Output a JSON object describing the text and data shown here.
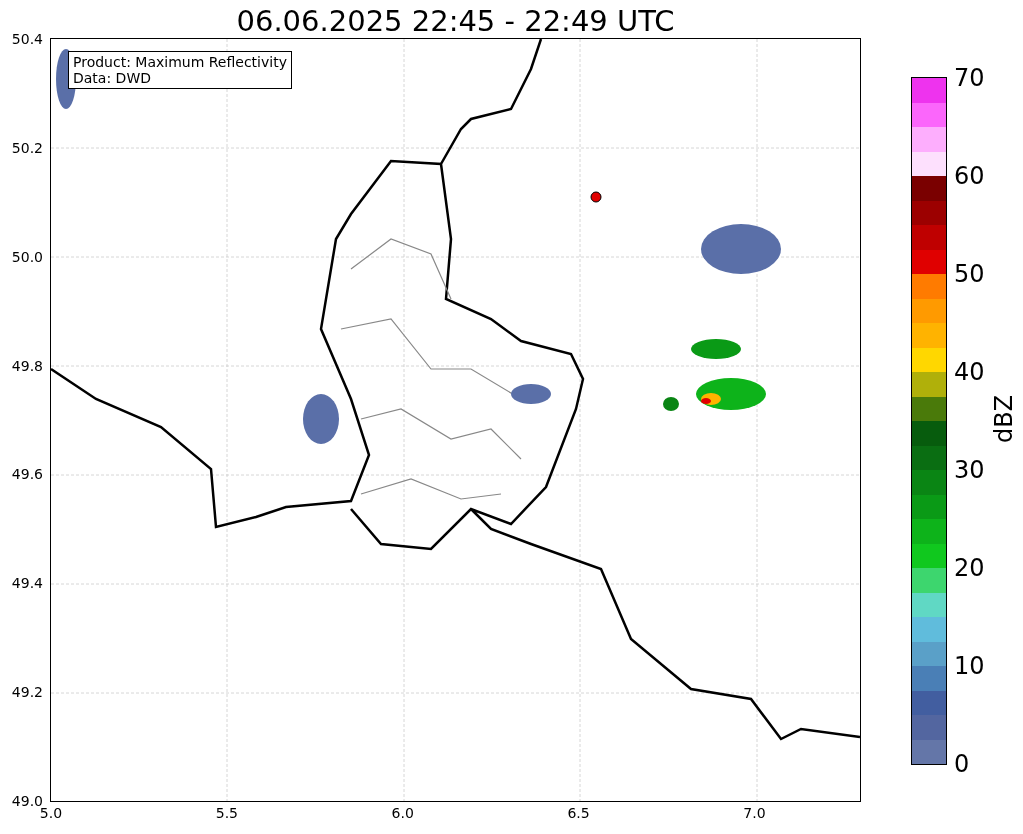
{
  "title": "06.06.2025 22:45 - 22:49 UTC",
  "info_box": {
    "lines": [
      "Product: Maximum Reflectivity",
      "Data: DWD"
    ]
  },
  "map": {
    "y_ticks": [
      "50.4",
      "50.2",
      "50.0",
      "49.8",
      "49.6",
      "49.4",
      "49.2",
      "49.0"
    ],
    "x_ticks": [
      "5.0",
      "5.5",
      "6.0",
      "6.5",
      "7.0"
    ]
  },
  "colorbar": {
    "label": "dBZ",
    "ticks": [
      "70",
      "60",
      "50",
      "40",
      "30",
      "20",
      "10",
      "0"
    ],
    "segments": [
      {
        "color": "#ee33ee"
      },
      {
        "color": "#fb66fb"
      },
      {
        "color": "#fdaefd"
      },
      {
        "color": "#fde0fd"
      },
      {
        "color": "#7a0000"
      },
      {
        "color": "#9c0000"
      },
      {
        "color": "#bf0000"
      },
      {
        "color": "#e00000"
      },
      {
        "color": "#ff7b00"
      },
      {
        "color": "#ff9a00"
      },
      {
        "color": "#ffb300"
      },
      {
        "color": "#ffd700"
      },
      {
        "color": "#b0b00a"
      },
      {
        "color": "#4a7a0a"
      },
      {
        "color": "#075c0d"
      },
      {
        "color": "#0a6e12"
      },
      {
        "color": "#0a8514"
      },
      {
        "color": "#0a9a16"
      },
      {
        "color": "#0db31a"
      },
      {
        "color": "#10c81e"
      },
      {
        "color": "#3dd66e"
      },
      {
        "color": "#60d8c4"
      },
      {
        "color": "#60bcdc"
      },
      {
        "color": "#5aa0c8"
      },
      {
        "color": "#4a7fb6"
      },
      {
        "color": "#425ea0"
      },
      {
        "color": "#5366a0"
      },
      {
        "color": "#6476a8"
      }
    ]
  }
}
